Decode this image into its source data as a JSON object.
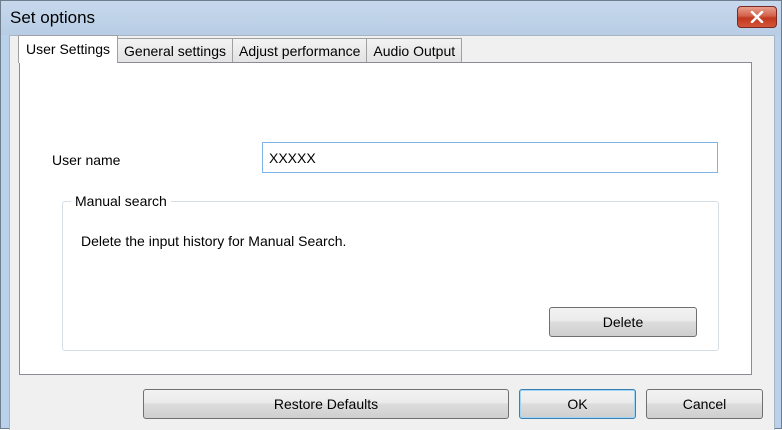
{
  "window": {
    "title": "Set options",
    "close_icon": "close-icon",
    "close_color": "#c9432a"
  },
  "tabs": [
    {
      "label": "User Settings",
      "active": true
    },
    {
      "label": "General settings",
      "active": false
    },
    {
      "label": "Adjust performance",
      "active": false
    },
    {
      "label": "Audio Output",
      "active": false
    }
  ],
  "user_settings": {
    "user_name_label": "User name",
    "user_name_value": "XXXXX",
    "manual_search": {
      "legend": "Manual search",
      "description": "Delete the input history for Manual Search.",
      "delete_label": "Delete"
    }
  },
  "footer": {
    "restore_label": "Restore Defaults",
    "ok_label": "OK",
    "cancel_label": "Cancel"
  }
}
